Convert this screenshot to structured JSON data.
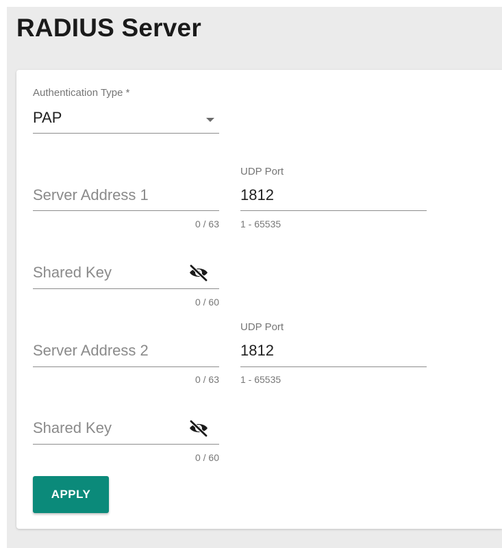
{
  "page": {
    "title": "RADIUS Server"
  },
  "auth_type": {
    "label": "Authentication Type *",
    "value": "PAP"
  },
  "server1": {
    "address": {
      "placeholder": "Server Address 1",
      "counter": "0 / 63"
    },
    "udp_port": {
      "label": "UDP Port",
      "value": "1812",
      "hint": "1 - 65535"
    },
    "shared_key": {
      "placeholder": "Shared Key",
      "counter": "0 / 60"
    }
  },
  "server2": {
    "address": {
      "placeholder": "Server Address 2",
      "counter": "0 / 63"
    },
    "udp_port": {
      "label": "UDP Port",
      "value": "1812",
      "hint": "1 - 65535"
    },
    "shared_key": {
      "placeholder": "Shared Key",
      "counter": "0 / 60"
    }
  },
  "actions": {
    "apply_label": "APPLY"
  },
  "colors": {
    "accent": "#0b8a7a",
    "background": "#ebebeb",
    "card": "#ffffff"
  },
  "icons": {
    "dropdown": "chevron-down-icon",
    "password_visibility": "eye-off-icon"
  }
}
